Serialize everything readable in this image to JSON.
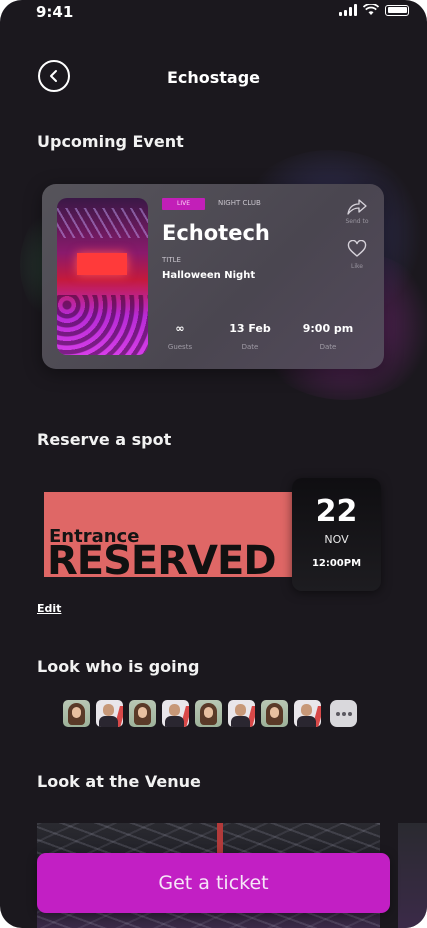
{
  "status_bar": {
    "time": "9:41"
  },
  "header": {
    "title": "Echostage"
  },
  "sections": {
    "upcoming": "Upcoming Event",
    "reserve": "Reserve a spot",
    "going": "Look who is going",
    "venue": "Look at the Venue"
  },
  "event": {
    "live_badge": "LIVE",
    "category": "NIGHT CLUB",
    "name": "Echotech",
    "subtitle_label": "TITLE",
    "subtitle": "Halloween Night",
    "share_label": "Send to",
    "like_label": "Like",
    "stats": [
      {
        "value": "∞",
        "label": "Guests"
      },
      {
        "value": "13 Feb",
        "label": "Date"
      },
      {
        "value": "9:00 pm",
        "label": "Date"
      }
    ]
  },
  "ticket": {
    "entrance": "Entrance",
    "reserved": "RESERVED",
    "day": "22",
    "month": "NOV",
    "time": "12:00PM",
    "edit_label": "Edit"
  },
  "attendees": {
    "avatar_types": [
      "woman",
      "man",
      "woman",
      "man",
      "woman",
      "man",
      "woman",
      "man"
    ],
    "more_icon": "ellipsis-icon"
  },
  "cta": {
    "label": "Get a ticket"
  },
  "colors": {
    "background": "#1b181e",
    "accent": "#c21fc4",
    "ticket": "#df6766"
  }
}
